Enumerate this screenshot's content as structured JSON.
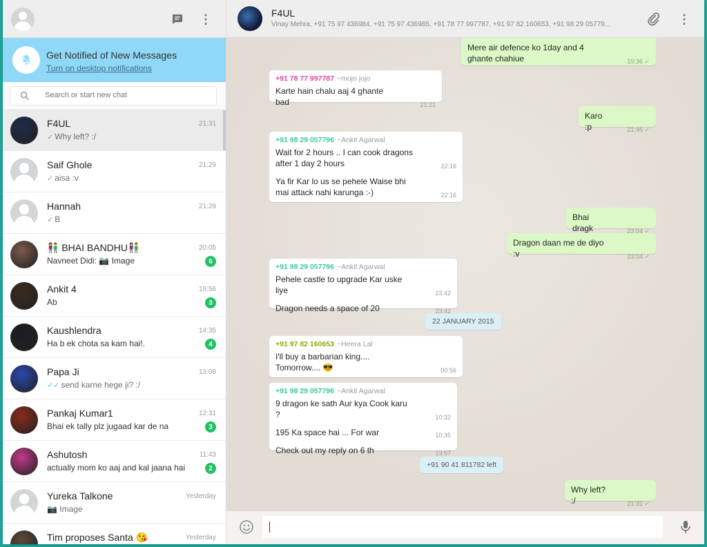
{
  "left": {
    "notify": {
      "title": "Get Notified of New Messages",
      "link": "Turn on desktop notifications"
    },
    "search": {
      "placeholder": "Search or start new chat"
    }
  },
  "chats": [
    {
      "name": "F4UL",
      "time": "21:31",
      "last": "Why left? :/",
      "tick": "✓",
      "badge": "",
      "avatar_color": "#1d2a4a",
      "active": true
    },
    {
      "name": "Saif Ghole",
      "time": "21:29",
      "last": "aisa :v",
      "tick": "✓",
      "badge": "",
      "avatar_color": "",
      "active": false
    },
    {
      "name": "Hannah",
      "time": "21:29",
      "last": "B",
      "tick": "✓",
      "badge": "",
      "avatar_color": "",
      "active": false
    },
    {
      "name": "👫 BHAI BANDHU👫",
      "time": "20:05",
      "last": "Navneet Didi: 📷 Image",
      "tick": "",
      "badge": "6",
      "avatar_color": "#7a5a4a",
      "active": false
    },
    {
      "name": "Ankit 4",
      "time": "19:56",
      "last": "Ab",
      "tick": "",
      "badge": "3",
      "avatar_color": "#3a2a1e",
      "active": false
    },
    {
      "name": "Kaushlendra",
      "time": "14:35",
      "last": "Ha b ek chota sa kam hai!.",
      "tick": "",
      "badge": "4",
      "avatar_color": "#1b1d24",
      "active": false
    },
    {
      "name": "Papa Ji",
      "time": "13:08",
      "last": "send karne hege ji? :/",
      "tick": "✓✓",
      "tick_blue": true,
      "badge": "",
      "avatar_color": "#2a47b0",
      "active": false
    },
    {
      "name": "Pankaj Kumar1",
      "time": "12:31",
      "last": "Bhai ek tally plz jugaad kar de na",
      "tick": "",
      "badge": "3",
      "avatar_color": "#8a2a1a",
      "active": false
    },
    {
      "name": "Ashutosh",
      "time": "11:43",
      "last": "actually mom ko aaj and kal jaana hai",
      "tick": "",
      "badge": "2",
      "avatar_color": "#c43a8a",
      "active": false
    },
    {
      "name": "Yureka Talkone",
      "time": "Yesterday",
      "last": "📷 Image",
      "tick": "",
      "badge": "",
      "avatar_color": "",
      "active": false
    },
    {
      "name": "Tim proposes Santa 😘",
      "time": "Yesterday",
      "last": "",
      "tick": "",
      "badge": "",
      "avatar_color": "#5a4a3a",
      "active": false
    }
  ],
  "conversation": {
    "name": "F4UL",
    "members": "Vinay Mehra, +91 75 97 436984, +91 75 97 436985, +91 78 77 997787, +91 97 82 160653, +91 98 29 05779..."
  },
  "messages": [
    {
      "dir": "out",
      "lines": [
        {
          "text": "Mere air defence ko 1day and 4 ghante chahiue",
          "time": "19:36 ✓"
        }
      ]
    },
    {
      "dir": "in",
      "sender": "+91 78 77 997787",
      "sender_name": "~mojo jojo",
      "color": "#e542a3",
      "lines": [
        {
          "text": "Karte hain chalu aaj 4 ghante bad",
          "time": "21:21"
        }
      ]
    },
    {
      "dir": "out",
      "lines": [
        {
          "text": "Karo :p",
          "time": "21:46 ✓"
        }
      ]
    },
    {
      "dir": "in",
      "sender": "+91 98 29 057796",
      "sender_name": "~Ankit Agarwal",
      "color": "#35cd96",
      "lines": [
        {
          "text": "Wait for 2 hours .. I can cook dragons after 1 day 2 hours",
          "time": "22:16"
        },
        {
          "text": "Ya fir Kar lo us se pehele Waise bhi mai attack nahi karunga :-)",
          "time": "22:16"
        }
      ]
    },
    {
      "dir": "out",
      "lines": [
        {
          "text": "Bhai dragk",
          "time": "23:04 ✓"
        }
      ]
    },
    {
      "dir": "out",
      "lines": [
        {
          "text": "Dragon daan me de diyo :v",
          "time": "23:04 ✓"
        }
      ]
    },
    {
      "dir": "in",
      "sender": "+91 98 29 057796",
      "sender_name": "~Ankit Agarwal",
      "color": "#35cd96",
      "lines": [
        {
          "text": "Pehele castle to upgrade Kar uske liye",
          "time": "23:42"
        },
        {
          "text": "Dragon needs a space of 20",
          "time": "23:42"
        }
      ]
    },
    {
      "dir": "sys",
      "text": "22 JANUARY 2015"
    },
    {
      "dir": "in",
      "sender": "+91 97 82 160653",
      "sender_name": "~Heera Lal",
      "color": "#91ab01",
      "lines": [
        {
          "text": "I'll buy a barbarian king.... Tomorrow.... 😎",
          "time": "00:56"
        }
      ]
    },
    {
      "dir": "in",
      "sender": "+91 98 29 057796",
      "sender_name": "~Ankit Agarwal",
      "color": "#35cd96",
      "lines": [
        {
          "text": "9 dragon ke sath Aur kya Cook karu ?",
          "time": "10:32"
        },
        {
          "text": "195 Ka space hai ... For war",
          "time": "10:35"
        },
        {
          "text": "Check out my reply on 6 th",
          "time": "19:57"
        }
      ]
    },
    {
      "dir": "sys",
      "text": "+91 90 41 811782 left"
    },
    {
      "dir": "out",
      "lines": [
        {
          "text": "Why left? :/",
          "time": "21:31 ✓"
        }
      ]
    }
  ],
  "compose": {
    "placeholder": ""
  }
}
